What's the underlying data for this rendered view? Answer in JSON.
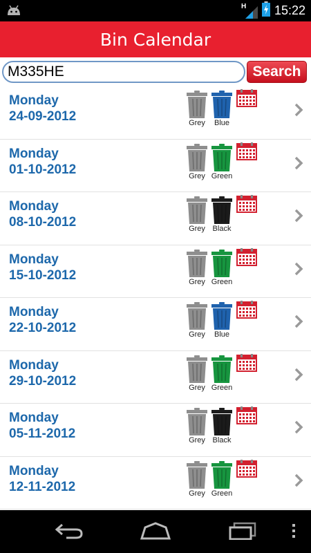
{
  "status": {
    "time": "15:22",
    "network": "H"
  },
  "title": "Bin Calendar",
  "search": {
    "value": "M335HE",
    "button_label": "Search"
  },
  "colors": {
    "accent": "#e8202f",
    "date_text": "#1d68ab",
    "bin_grey": "#8e8e8e",
    "bin_blue": "#1f62ad",
    "bin_green": "#17953f",
    "bin_black": "#1b1b1b"
  },
  "collections": [
    {
      "day": "Monday",
      "date": "24-09-2012",
      "bins": [
        {
          "label": "Grey",
          "color": "#8e8e8e"
        },
        {
          "label": "Blue",
          "color": "#1f62ad"
        }
      ]
    },
    {
      "day": "Monday",
      "date": "01-10-2012",
      "bins": [
        {
          "label": "Grey",
          "color": "#8e8e8e"
        },
        {
          "label": "Green",
          "color": "#17953f"
        }
      ]
    },
    {
      "day": "Monday",
      "date": "08-10-2012",
      "bins": [
        {
          "label": "Grey",
          "color": "#8e8e8e"
        },
        {
          "label": "Black",
          "color": "#1b1b1b"
        }
      ]
    },
    {
      "day": "Monday",
      "date": "15-10-2012",
      "bins": [
        {
          "label": "Grey",
          "color": "#8e8e8e"
        },
        {
          "label": "Green",
          "color": "#17953f"
        }
      ]
    },
    {
      "day": "Monday",
      "date": "22-10-2012",
      "bins": [
        {
          "label": "Grey",
          "color": "#8e8e8e"
        },
        {
          "label": "Blue",
          "color": "#1f62ad"
        }
      ]
    },
    {
      "day": "Monday",
      "date": "29-10-2012",
      "bins": [
        {
          "label": "Grey",
          "color": "#8e8e8e"
        },
        {
          "label": "Green",
          "color": "#17953f"
        }
      ]
    },
    {
      "day": "Monday",
      "date": "05-11-2012",
      "bins": [
        {
          "label": "Grey",
          "color": "#8e8e8e"
        },
        {
          "label": "Black",
          "color": "#1b1b1b"
        }
      ]
    },
    {
      "day": "Monday",
      "date": "12-11-2012",
      "bins": [
        {
          "label": "Grey",
          "color": "#8e8e8e"
        },
        {
          "label": "Green",
          "color": "#17953f"
        }
      ]
    }
  ],
  "icons": {
    "notification": "android-icon",
    "calendar": "calendar-icon",
    "row_action": "chevron-right-icon",
    "back": "back-icon",
    "home": "home-icon",
    "recents": "recent-apps-icon",
    "menu": "overflow-menu-icon"
  }
}
